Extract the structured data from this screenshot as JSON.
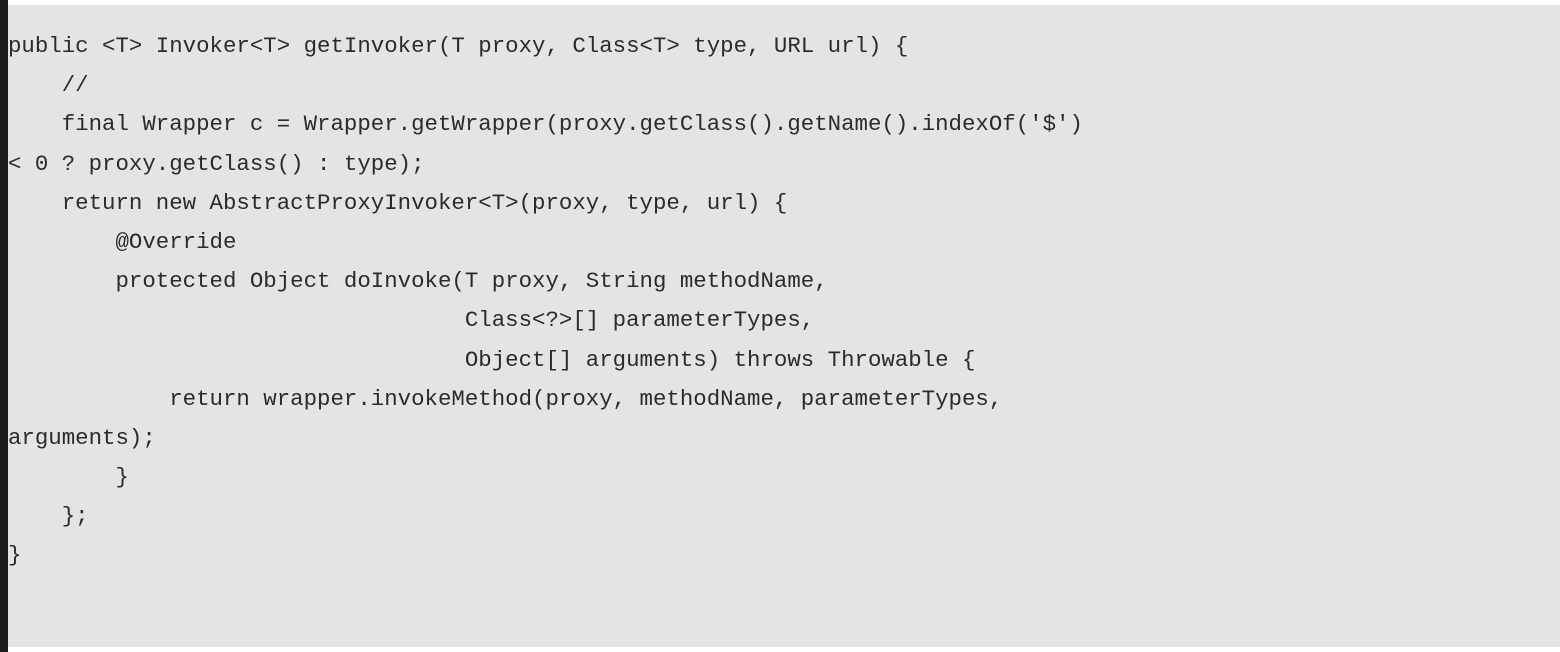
{
  "code": {
    "lines": [
      "public <T> Invoker<T> getInvoker(T proxy, Class<T> type, URL url) {",
      "    //",
      "    final Wrapper c = Wrapper.getWrapper(proxy.getClass().getName().indexOf('$')",
      "< 0 ? proxy.getClass() : type);",
      "    return new AbstractProxyInvoker<T>(proxy, type, url) {",
      "        @Override",
      "        protected Object doInvoke(T proxy, String methodName,",
      "                                  Class<?>[] parameterTypes,",
      "                                  Object[] arguments) throws Throwable {",
      "            return wrapper.invokeMethod(proxy, methodName, parameterTypes,",
      "arguments);",
      "        }",
      "    };",
      "}"
    ]
  }
}
